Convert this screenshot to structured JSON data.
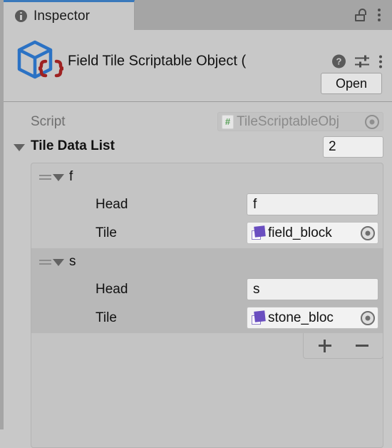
{
  "tab": {
    "label": "Inspector",
    "icon": "info-icon",
    "active_color": "#3a79bb",
    "lock_icon": "lock-open-icon",
    "menu_icon": "kebab-menu-icon"
  },
  "header": {
    "title": "Field Tile Scriptable Object (",
    "icon": "scriptable-object-icon",
    "help_label": "?",
    "help_icon": "help-icon",
    "preset_icon": "preset-settings-icon",
    "menu_icon": "kebab-menu-icon",
    "open_label": "Open"
  },
  "script": {
    "label": "Script",
    "value": "TileScriptableObj",
    "type_icon": "cs-script-icon",
    "type_glyph": "#",
    "picker_icon": "object-picker-icon"
  },
  "list": {
    "label": "Tile Data List",
    "size": "2",
    "foldout_icon": "foldout-expanded-icon",
    "add_label": "+",
    "remove_label": "–",
    "add_icon": "plus-icon",
    "remove_icon": "minus-icon",
    "elements": [
      {
        "name": "f",
        "drag_icon": "drag-handle-icon",
        "foldout_icon": "foldout-expanded-icon",
        "fields": [
          {
            "label": "Head",
            "value": "f",
            "kind": "text"
          },
          {
            "label": "Tile",
            "value": "field_block",
            "kind": "object",
            "asset_icon": "tile-asset-icon",
            "picker_icon": "object-picker-icon"
          }
        ]
      },
      {
        "name": "s",
        "drag_icon": "drag-handle-icon",
        "foldout_icon": "foldout-expanded-icon",
        "fields": [
          {
            "label": "Head",
            "value": "s",
            "kind": "text"
          },
          {
            "label": "Tile",
            "value": "stone_bloc",
            "kind": "object",
            "asset_icon": "tile-asset-icon",
            "picker_icon": "object-picker-icon"
          }
        ]
      }
    ]
  },
  "colors": {
    "background": "#c8c8c8",
    "tabbar": "#a5a5a5",
    "accent": "#3a79bb",
    "asset_purple": "#6a4ec0",
    "script_green": "#5aa05a"
  }
}
